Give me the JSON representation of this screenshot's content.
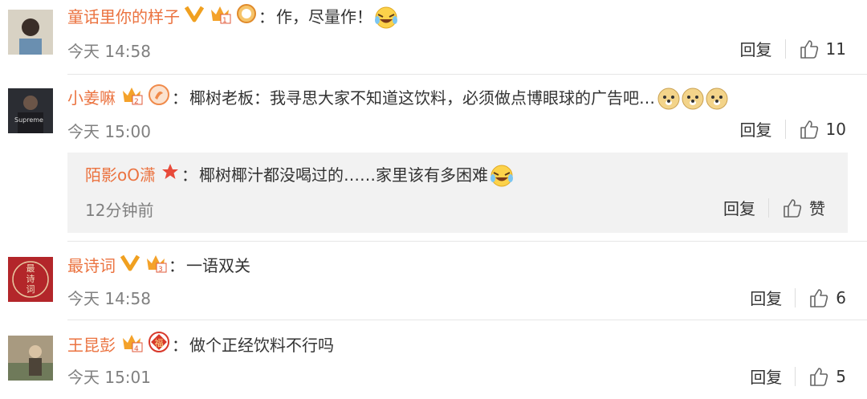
{
  "comments": [
    {
      "user": "童话里你的样子",
      "sep": "：",
      "text": "作，尽量作！",
      "time": "今天 14:58",
      "reply": "回复",
      "likes": "11"
    },
    {
      "user": "小姜嘛",
      "sep": "：",
      "text": "椰树老板：我寻思大家不知道这饮料，必须做点博眼球的广告吧…",
      "time": "今天 15:00",
      "reply": "回复",
      "likes": "10",
      "sub": {
        "user": "陌影oO潇",
        "sep": "：",
        "text": "椰树椰汁都没喝过的……家里该有多困难",
        "time": "12分钟前",
        "reply": "回复",
        "likes": "赞"
      }
    },
    {
      "user": "最诗词",
      "sep": "：",
      "text": "一语双关",
      "time": "今天 14:58",
      "reply": "回复",
      "likes": "6",
      "avatar_text": "最诗词"
    },
    {
      "user": "王昆彭",
      "sep": "：",
      "text": "做个正经饮料不行吗",
      "time": "今天 15:01",
      "reply": "回复",
      "likes": "5",
      "fu": "福"
    }
  ],
  "colors": {
    "username": "#eb7340",
    "meta": "#808080",
    "text": "#333333",
    "subbox": "#f2f2f2",
    "vip": "#f0a020"
  },
  "icons": [
    "verified-v-icon",
    "crown-vip-icon",
    "medal-icon",
    "laugh-cry-emoji",
    "doge-emoji",
    "star-icon",
    "thumbs-up-icon"
  ]
}
